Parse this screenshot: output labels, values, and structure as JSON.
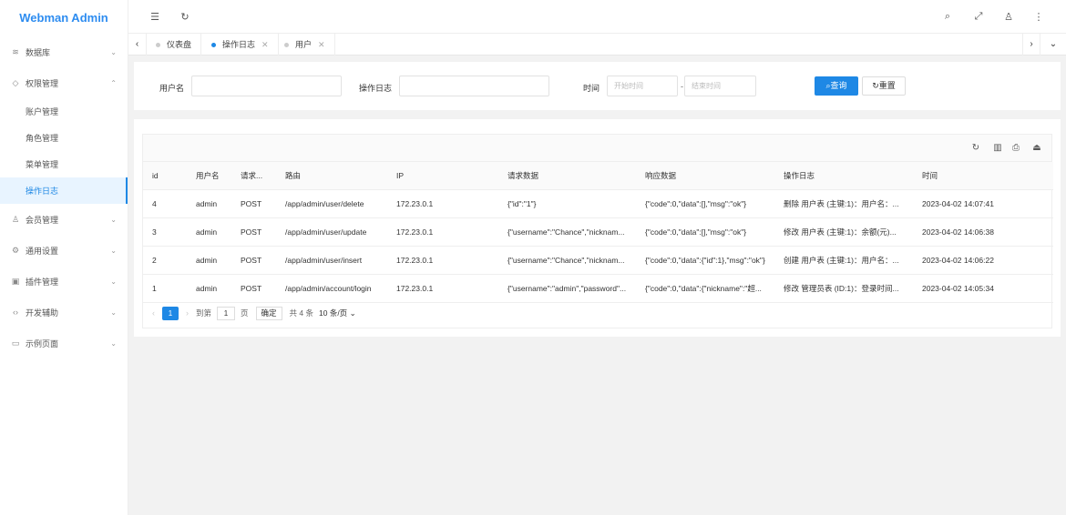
{
  "app": {
    "title": "Webman Admin"
  },
  "sidebar": {
    "menus": [
      {
        "label": "数据库",
        "icon": "database-icon",
        "chev": "⌄"
      },
      {
        "label": "权限管理",
        "icon": "shield-icon",
        "chev": "⌃"
      },
      {
        "label": "会员管理",
        "icon": "user-icon",
        "chev": "⌄"
      },
      {
        "label": "通用设置",
        "icon": "gear-icon",
        "chev": "⌄"
      },
      {
        "label": "插件管理",
        "icon": "plugin-icon",
        "chev": "⌄"
      },
      {
        "label": "开发辅助",
        "icon": "code-icon",
        "chev": "⌄"
      },
      {
        "label": "示例页面",
        "icon": "example-icon",
        "chev": "⌄"
      }
    ],
    "submenus": [
      "账户管理",
      "角色管理",
      "菜单管理",
      "操作日志"
    ]
  },
  "tabs": [
    {
      "label": "仪表盘"
    },
    {
      "label": "操作日志"
    },
    {
      "label": "用户"
    }
  ],
  "search": {
    "username_label": "用户名",
    "oplog_label": "操作日志",
    "time_label": "时间",
    "start_placeholder": "开始时间",
    "separator": "-",
    "end_placeholder": "结束时间",
    "query_label": "查询",
    "reset_label": "重置"
  },
  "table": {
    "columns": [
      "id",
      "用户名",
      "请求...",
      "路由",
      "IP",
      "请求数据",
      "响应数据",
      "操作日志",
      "时间"
    ],
    "rows": [
      [
        "4",
        "admin",
        "POST",
        "/app/admin/user/delete",
        "172.23.0.1",
        "{\"id\":\"1\"}",
        "{\"code\":0,\"data\":[],\"msg\":\"ok\"}",
        "删除 用户表 (主键:1)：用户名：...",
        "2023-04-02 14:07:41"
      ],
      [
        "3",
        "admin",
        "POST",
        "/app/admin/user/update",
        "172.23.0.1",
        "{\"username\":\"Chance\",\"nicknam...",
        "{\"code\":0,\"data\":[],\"msg\":\"ok\"}",
        "修改 用户表 (主键:1)：余额(元)...",
        "2023-04-02 14:06:38"
      ],
      [
        "2",
        "admin",
        "POST",
        "/app/admin/user/insert",
        "172.23.0.1",
        "{\"username\":\"Chance\",\"nicknam...",
        "{\"code\":0,\"data\":{\"id\":1},\"msg\":\"ok\"}",
        "创建 用户表 (主键:1)：用户名：...",
        "2023-04-02 14:06:22"
      ],
      [
        "1",
        "admin",
        "POST",
        "/app/admin/account/login",
        "172.23.0.1",
        "{\"username\":\"admin\",\"password\"...",
        "{\"code\":0,\"data\":{\"nickname\":\"超...",
        "修改 管理员表 (ID:1)：登录时间...",
        "2023-04-02 14:05:34"
      ]
    ]
  },
  "pager": {
    "current": "1",
    "goto_label": "到第",
    "page_value": "1",
    "page_unit": "页",
    "confirm_label": "确定",
    "total_label": "共 4 条",
    "size_label": "10 条/页"
  },
  "colors": {
    "accent": "#1e88e5",
    "brand": "#2d8cf0"
  }
}
